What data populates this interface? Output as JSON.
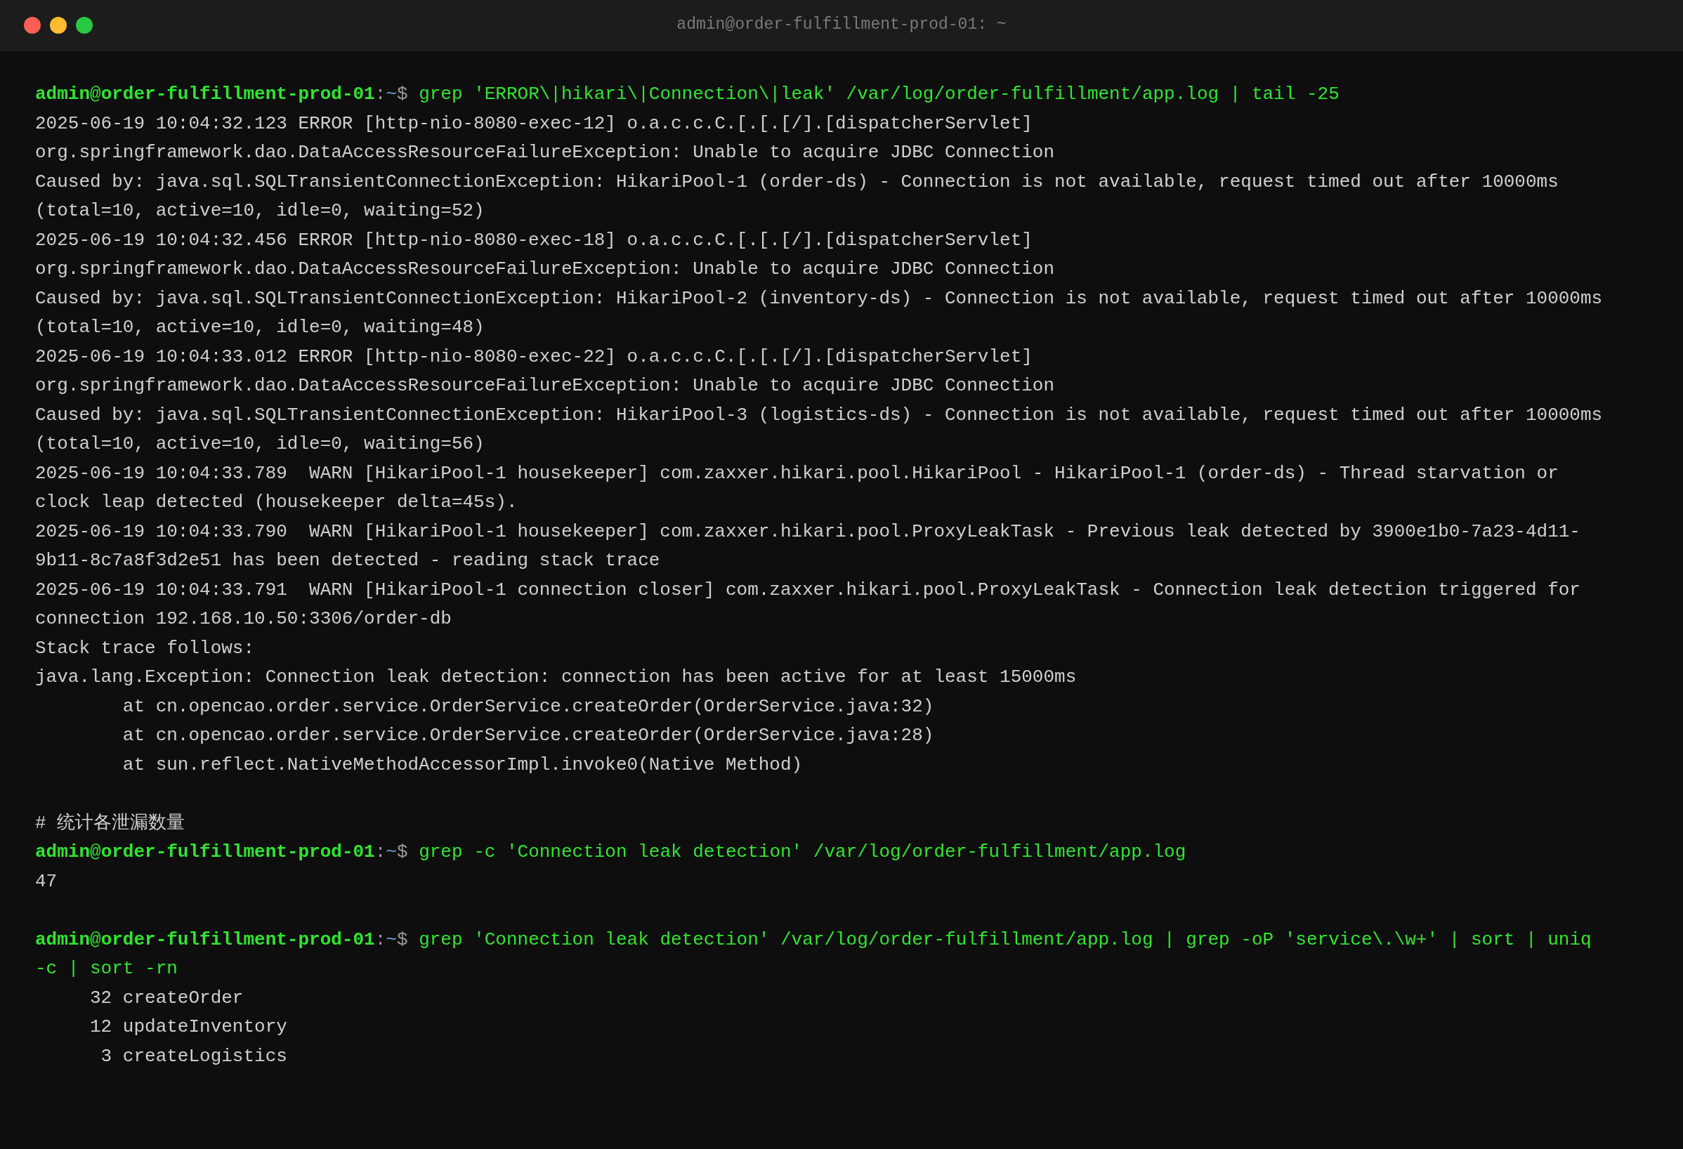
{
  "window": {
    "title": "admin@order-fulfillment-prod-01: ~"
  },
  "lines": [
    {
      "kind": "prompt",
      "user": "admin",
      "at": "@",
      "host": "order-fulfillment-prod-01",
      "colon": ":",
      "path": "~",
      "symbol": "$",
      "command": "grep 'ERROR\\|hikari\\|Connection\\|leak' /var/log/order-fulfillment/app.log | tail -25"
    },
    {
      "kind": "output",
      "text": "2025-06-19 10:04:32.123 ERROR [http-nio-8080-exec-12] o.a.c.c.C.[.[.[/].[dispatcherServlet]"
    },
    {
      "kind": "output",
      "text": "org.springframework.dao.DataAccessResourceFailureException: Unable to acquire JDBC Connection"
    },
    {
      "kind": "output",
      "text": "Caused by: java.sql.SQLTransientConnectionException: HikariPool-1 (order-ds) - Connection is not available, request timed out after 10000ms"
    },
    {
      "kind": "output",
      "text": "(total=10, active=10, idle=0, waiting=52)"
    },
    {
      "kind": "output",
      "text": "2025-06-19 10:04:32.456 ERROR [http-nio-8080-exec-18] o.a.c.c.C.[.[.[/].[dispatcherServlet]"
    },
    {
      "kind": "output",
      "text": "org.springframework.dao.DataAccessResourceFailureException: Unable to acquire JDBC Connection"
    },
    {
      "kind": "output",
      "text": "Caused by: java.sql.SQLTransientConnectionException: HikariPool-2 (inventory-ds) - Connection is not available, request timed out after 10000ms"
    },
    {
      "kind": "output",
      "text": "(total=10, active=10, idle=0, waiting=48)"
    },
    {
      "kind": "output",
      "text": "2025-06-19 10:04:33.012 ERROR [http-nio-8080-exec-22] o.a.c.c.C.[.[.[/].[dispatcherServlet]"
    },
    {
      "kind": "output",
      "text": "org.springframework.dao.DataAccessResourceFailureException: Unable to acquire JDBC Connection"
    },
    {
      "kind": "output",
      "text": "Caused by: java.sql.SQLTransientConnectionException: HikariPool-3 (logistics-ds) - Connection is not available, request timed out after 10000ms"
    },
    {
      "kind": "output",
      "text": "(total=10, active=10, idle=0, waiting=56)"
    },
    {
      "kind": "output",
      "text": "2025-06-19 10:04:33.789  WARN [HikariPool-1 housekeeper] com.zaxxer.hikari.pool.HikariPool - HikariPool-1 (order-ds) - Thread starvation or"
    },
    {
      "kind": "output",
      "text": "clock leap detected (housekeeper delta=45s)."
    },
    {
      "kind": "output",
      "text": "2025-06-19 10:04:33.790  WARN [HikariPool-1 housekeeper] com.zaxxer.hikari.pool.ProxyLeakTask - Previous leak detected by 3900e1b0-7a23-4d11-"
    },
    {
      "kind": "output",
      "text": "9b11-8c7a8f3d2e51 has been detected - reading stack trace"
    },
    {
      "kind": "output",
      "text": "2025-06-19 10:04:33.791  WARN [HikariPool-1 connection closer] com.zaxxer.hikari.pool.ProxyLeakTask - Connection leak detection triggered for"
    },
    {
      "kind": "output",
      "text": "connection 192.168.10.50:3306/order-db"
    },
    {
      "kind": "output",
      "text": "Stack trace follows:"
    },
    {
      "kind": "output",
      "text": "java.lang.Exception: Connection leak detection: connection has been active for at least 15000ms"
    },
    {
      "kind": "output",
      "text": "        at cn.opencao.order.service.OrderService.createOrder(OrderService.java:32)"
    },
    {
      "kind": "output",
      "text": "        at cn.opencao.order.service.OrderService.createOrder(OrderService.java:28)"
    },
    {
      "kind": "output",
      "text": "        at sun.reflect.NativeMethodAccessorImpl.invoke0(Native Method)"
    },
    {
      "kind": "blank"
    },
    {
      "kind": "comment",
      "text": "# 统计各泄漏数量"
    },
    {
      "kind": "prompt",
      "user": "admin",
      "at": "@",
      "host": "order-fulfillment-prod-01",
      "colon": ":",
      "path": "~",
      "symbol": "$",
      "command": "grep -c 'Connection leak detection' /var/log/order-fulfillment/app.log"
    },
    {
      "kind": "output",
      "text": "47"
    },
    {
      "kind": "blank"
    },
    {
      "kind": "prompt",
      "user": "admin",
      "at": "@",
      "host": "order-fulfillment-prod-01",
      "colon": ":",
      "path": "~",
      "symbol": "$",
      "command": "grep 'Connection leak detection' /var/log/order-fulfillment/app.log | grep -oP 'service\\.\\w+' | sort | uniq"
    },
    {
      "kind": "continuation",
      "text": "-c | sort -rn"
    },
    {
      "kind": "output",
      "text": "     32 createOrder"
    },
    {
      "kind": "output",
      "text": "     12 updateInventory"
    },
    {
      "kind": "output",
      "text": "      3 createLogistics"
    }
  ]
}
